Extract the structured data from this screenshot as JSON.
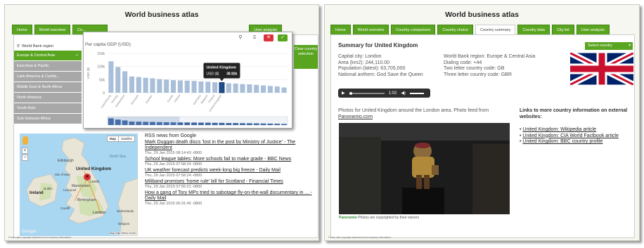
{
  "left": {
    "title": "World business atlas",
    "tabs": [
      "Home",
      "World overview",
      "Co..."
    ],
    "tabs_right": [
      "User analysis"
    ],
    "world_bank": {
      "heading": "World Bank region",
      "items": [
        "Europe & Central Asia",
        "East Asia & Pacific",
        "Latin America & Caribb...",
        "Middle East & North Africa",
        "North America",
        "South Asia",
        "Sub-Saharan Africa"
      ],
      "check": "✓"
    },
    "chart": {
      "close": "✕",
      "confirm": "✓",
      "pin": "⚲",
      "pin2": "⍗"
    },
    "clear_button": "Clear country selection",
    "map": {
      "btn_map": "Map",
      "btn_sat": "Satellite",
      "plus": "+",
      "minus": "−",
      "logo": "Google",
      "terms": "Map Data  Terms of Use",
      "labels": [
        "Edinburgh",
        "United Kingdom",
        "Leeds",
        "Ireland",
        "Manchester",
        "Isle of Man",
        "Birmingham",
        "London",
        "Netherlands",
        "Belgium",
        "North Sea",
        "Cardiff",
        "Liverpool",
        "Dublin"
      ]
    },
    "rss": {
      "heading": "RSS news from Google",
      "items": [
        {
          "title": "Mark Duggan death discs 'lost in the post by Ministry of Justice' - The Independent",
          "date": "Thu, 29 Jan 2015 08:14:43 -0800"
        },
        {
          "title": "School league tables: More schools fail to make grade - BBC News",
          "date": "Thu, 29 Jan 2015 07:58:24 -0800"
        },
        {
          "title": "UK weather forecast predicts week-long big freeze - Daily Mail",
          "date": "Thu, 29 Jan 2015 07:58:24 -0800"
        },
        {
          "title": "Miliband promises 'home rule' bill for Scotland - Financial Times",
          "date": "Thu, 29 Jan 2015 07:55:21 -0800"
        },
        {
          "title": "How a gang of Tory MPs tried to sabotage fly-on-the-wall documentary in ... - Daily Mail",
          "date": "Thu, 29 Jan 2015 06:31:46 -0800"
        }
      ]
    },
    "footer": "Footer with copyright statement and company information."
  },
  "chart_data": {
    "type": "bar",
    "title": "Per capita GDP (USD)",
    "ylabel": "USD ($)",
    "yticks": [
      "150k",
      "100k",
      "50k",
      "0"
    ],
    "ylim": [
      0,
      150000
    ],
    "values": [
      120000,
      98000,
      82000,
      62000,
      60000,
      57000,
      55000,
      52000,
      50000,
      48000,
      47000,
      46000,
      45000,
      43000,
      42000,
      40000,
      38920,
      36000,
      35000,
      33000,
      32000,
      30000,
      28000,
      26000,
      24000,
      20000
    ],
    "highlight_index": 16,
    "categories": [
      "Luxembourg",
      "Norway",
      "Switzerland",
      "",
      "Denmark",
      "",
      "Sweden",
      "",
      "",
      "Austria",
      "Ireland",
      "",
      "",
      "Germany",
      "Belgium",
      "Finland",
      "United Kingdom",
      "",
      "",
      "",
      "",
      "",
      "",
      "",
      "",
      ""
    ],
    "tooltip": {
      "country": "United Kingdom",
      "label": "USD ($)",
      "value": "38.92k"
    }
  },
  "right": {
    "title": "World business atlas",
    "tabs": [
      "Home",
      "World overview",
      "Country comparison",
      "Country choice",
      "Country summary",
      "Country data",
      "City list",
      "User analysis"
    ],
    "active_tab": "Country summary",
    "summary_heading": "Summary for United Kingdom",
    "select_country": "Select country",
    "info_left": [
      "Capital city: London",
      "Area (km2): 244,110.00",
      "Population (latest): 63,705,000",
      "National anthem: God Save the Queen"
    ],
    "info_right": [
      "World Bank region: Europe & Central Asia",
      "Dialing code: +44",
      "Two letter country code: GB",
      "Three letter country code: GBR"
    ],
    "audio_time": "1:02",
    "photos_text": "Photos for United Kingdom around the London area. Photo feed from",
    "photos_link": "Panoramio.com",
    "photo_credit_logo": "Panoramio",
    "photo_credit": "Photos are copyrighted by their owners",
    "links_heading": "Links to more country information on external websites:",
    "links": [
      "United Kingdom: Wikipedia article",
      "United Kingdom: CIA World Factbook article",
      "United Kingdom: BBC country profile"
    ],
    "footer": "Footer with copyright statement and company information."
  }
}
